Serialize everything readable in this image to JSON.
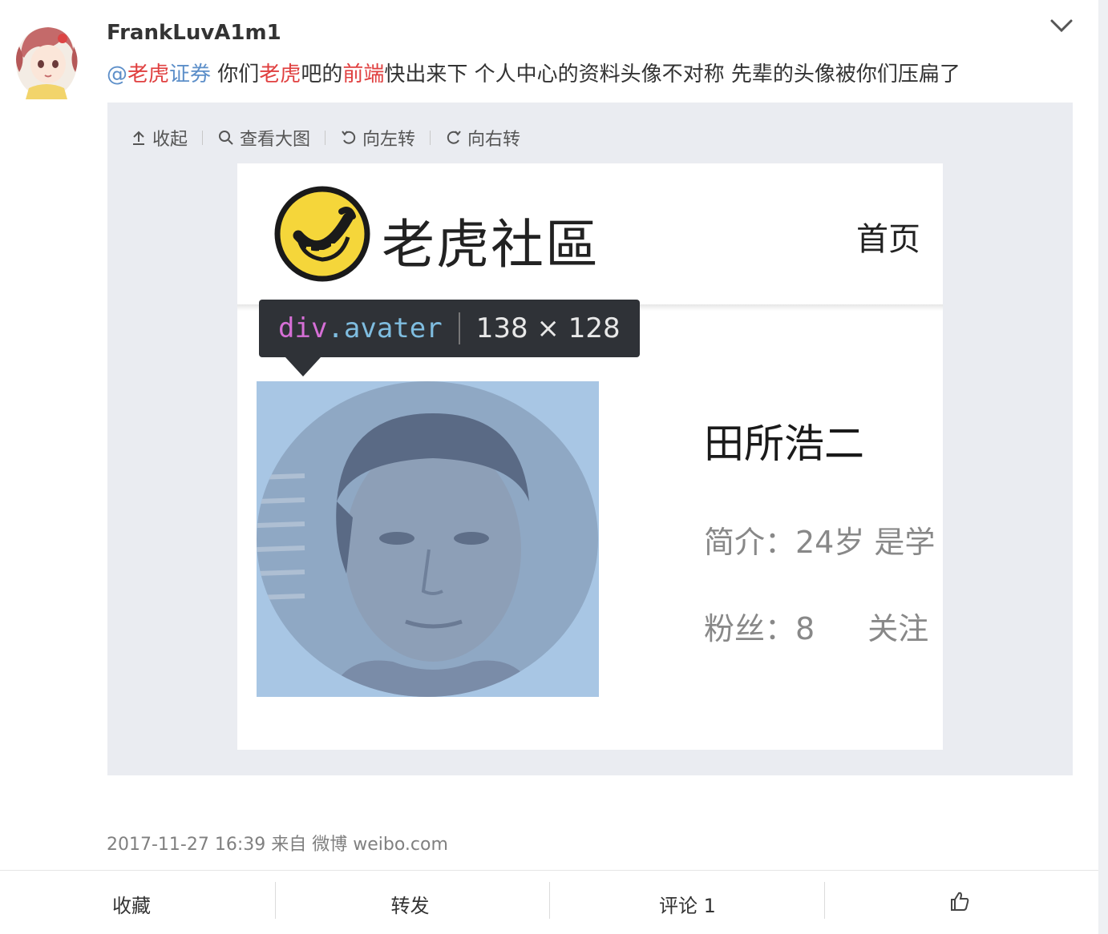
{
  "post": {
    "username": "FrankLuvA1m1",
    "text": {
      "at": "@",
      "mention_part1": "老虎",
      "mention_part2": "证券",
      "seg1": " 你们",
      "hl1": "老虎",
      "seg2": "吧的",
      "hl2": "前端",
      "seg3": "快出来下 个人中心的资料头像不对称 先辈的头像被你们压扁了"
    },
    "meta": "2017-11-27 16:39 来自 微博 weibo.com"
  },
  "media_toolbar": {
    "collapse_label": "收起",
    "view_large_label": "查看大图",
    "rotate_left_label": "向左转",
    "rotate_right_label": "向右转"
  },
  "screenshot": {
    "brand_name": "老虎社區",
    "nav_home": "首页",
    "tooltip_tag": "div",
    "tooltip_class": ".avater",
    "tooltip_dims": "138 × 128",
    "profile_name": "田所浩二",
    "profile_bio": "简介：24岁 是学",
    "profile_fans": "粉丝：8",
    "profile_follow": "关注"
  },
  "actions": {
    "favorite_label": "收藏",
    "repost_label": "转发",
    "comment_label": "评论 1"
  },
  "colors": {
    "mention_red": "#e04040",
    "mention_blue": "#5d8fc9",
    "tooltip_bg": "#2f3237",
    "avatar_highlight": "#a8c6e4",
    "tiger_yellow": "#f5d63a"
  },
  "icons": {
    "collapse": "arrow-up-icon",
    "view_large": "magnifier-icon",
    "rotate_left": "rotate-left-icon",
    "rotate_right": "rotate-right-icon",
    "like": "thumbs-up-icon",
    "menu": "chevron-down-icon"
  }
}
